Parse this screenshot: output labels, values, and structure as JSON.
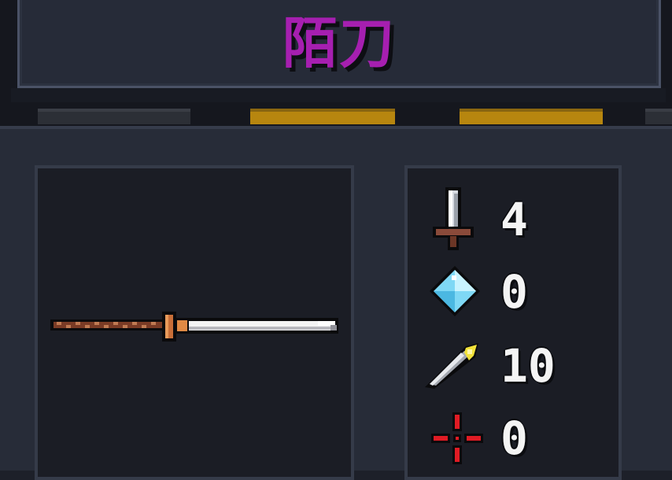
{
  "weapon": {
    "name": "陌刀"
  },
  "energy_bars": [
    {
      "state": "empty",
      "color": "#2c2f36"
    },
    {
      "state": "filled",
      "color": "#b7860f"
    },
    {
      "state": "filled",
      "color": "#b7860f"
    },
    {
      "state": "empty",
      "color": "#2c2f36"
    }
  ],
  "stats": [
    {
      "icon": "sword-icon",
      "label": "damage",
      "value": "4"
    },
    {
      "icon": "crystal-icon",
      "label": "energy-cost",
      "value": "0"
    },
    {
      "icon": "feather-blade-icon",
      "label": "critical",
      "value": "10"
    },
    {
      "icon": "crosshair-icon",
      "label": "inaccuracy",
      "value": "0"
    }
  ],
  "colors": {
    "name": "#a61fb0",
    "bar_fill": "#b7860f",
    "panel": "#272c38",
    "box": "#1b1d25"
  }
}
